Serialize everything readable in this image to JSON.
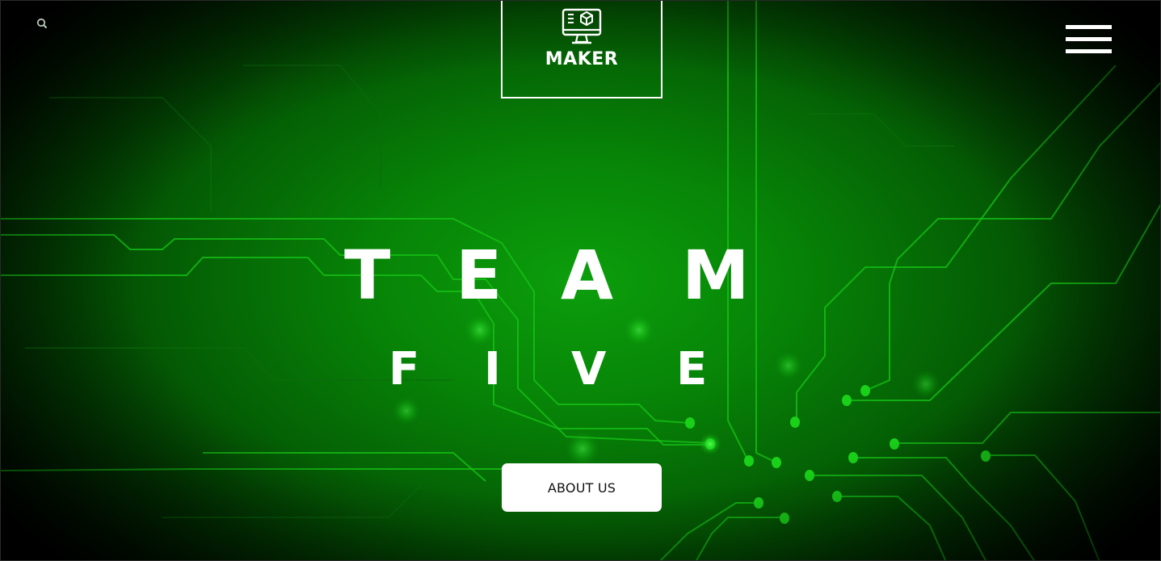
{
  "header": {
    "search_icon": "search-icon",
    "logo": {
      "icon": "monitor-cube-icon",
      "text": "MAKER"
    },
    "menu_icon": "hamburger-menu-icon"
  },
  "hero": {
    "title_line_1": [
      "T",
      "E",
      "A",
      "M"
    ],
    "title_line_2": [
      "F",
      "I",
      "V",
      "E"
    ],
    "cta_label": "ABOUT US",
    "background": "circuit-board",
    "accent_color": "#0a8f0a",
    "text_color": "#ffffff"
  }
}
